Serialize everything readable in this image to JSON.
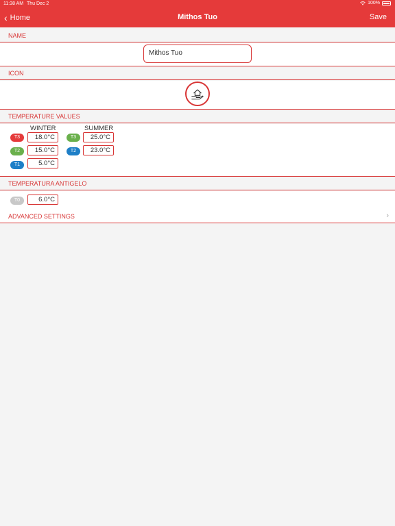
{
  "status_bar": {
    "time": "11:38 AM",
    "date": "Thu Dec 2",
    "battery": "100%"
  },
  "nav": {
    "back_label": "Home",
    "title": "Mithos Tuo",
    "save_label": "Save"
  },
  "name_section": {
    "header": "NAME",
    "value": "Mithos Tuo"
  },
  "icon_section": {
    "header": "ICON",
    "icon": "house-hand-icon"
  },
  "temperature_section": {
    "header": "TEMPERATURE VALUES",
    "winter_label": "WINTER",
    "summer_label": "SUMMER",
    "winter": [
      {
        "tag": "T3",
        "value": "18.0°C",
        "color": "#e53a3a"
      },
      {
        "tag": "T2",
        "value": "15.0°C",
        "color": "#6ab04c"
      },
      {
        "tag": "T1",
        "value": "5.0°C",
        "color": "#1e7fc7"
      }
    ],
    "summer": [
      {
        "tag": "T3",
        "value": "25.0°C",
        "color": "#6ab04c"
      },
      {
        "tag": "T2",
        "value": "23.0°C",
        "color": "#1e7fc7"
      }
    ]
  },
  "antigelo_section": {
    "header": "TEMPERATURA ANTIGELO",
    "tag": "T0",
    "value": "6.0°C",
    "color": "#c8c8c8"
  },
  "advanced": {
    "label": "ADVANCED SETTINGS"
  },
  "colors": {
    "accent": "#e53a3a"
  }
}
